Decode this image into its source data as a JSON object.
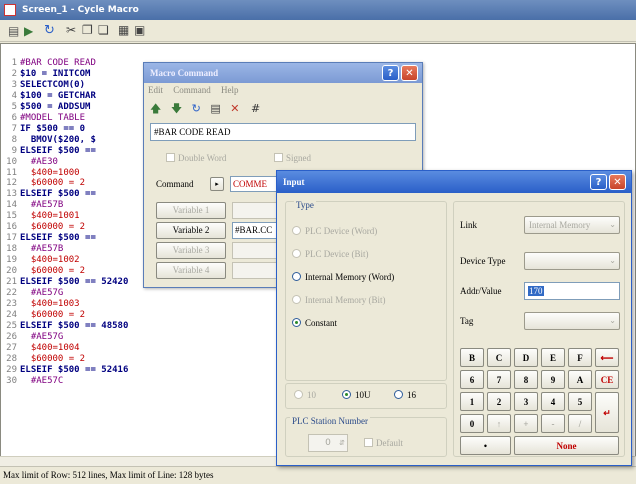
{
  "editor": {
    "title": "Screen_1 - Cycle Macro",
    "status": "Max limit of Row: 512 lines, Max limit of Line: 128 bytes",
    "lines": [
      {
        "n": "1",
        "t": "#BAR CODE READ"
      },
      {
        "n": "2",
        "t": "$10 = INITCOM"
      },
      {
        "n": "3",
        "t": "SELECTCOM(0)"
      },
      {
        "n": "4",
        "t": "$100 = GETCHAR"
      },
      {
        "n": "5",
        "t": "$500 = ADDSUM"
      },
      {
        "n": "6",
        "t": "#MODEL TABLE"
      },
      {
        "n": "7",
        "t": "IF $500 == 0"
      },
      {
        "n": "8",
        "t": "  BMOV($200, $"
      },
      {
        "n": "9",
        "t": "ELSEIF $500 =="
      },
      {
        "n": "10",
        "t": "  #AE30"
      },
      {
        "n": "11",
        "t": "  $400=1000"
      },
      {
        "n": "12",
        "t": "  $60000 = 2"
      },
      {
        "n": "13",
        "t": "ELSEIF $500 =="
      },
      {
        "n": "14",
        "t": "  #AE57B"
      },
      {
        "n": "15",
        "t": "  $400=1001"
      },
      {
        "n": "16",
        "t": "  $60000 = 2"
      },
      {
        "n": "17",
        "t": "ELSEIF $500 =="
      },
      {
        "n": "18",
        "t": "  #AE57B"
      },
      {
        "n": "19",
        "t": "  $400=1002"
      },
      {
        "n": "20",
        "t": "  $60000 = 2"
      },
      {
        "n": "21",
        "t": "ELSEIF $500 == 52420"
      },
      {
        "n": "22",
        "t": "  #AE57G"
      },
      {
        "n": "23",
        "t": "  $400=1003"
      },
      {
        "n": "24",
        "t": "  $60000 = 2"
      },
      {
        "n": "25",
        "t": "ELSEIF $500 == 48580"
      },
      {
        "n": "26",
        "t": "  #AE57G"
      },
      {
        "n": "27",
        "t": "  $400=1004"
      },
      {
        "n": "28",
        "t": "  $60000 = 2"
      },
      {
        "n": "29",
        "t": "ELSEIF $500 == 52416"
      },
      {
        "n": "30",
        "t": "  #AE57C"
      }
    ]
  },
  "macro": {
    "title": "Macro Command",
    "menu": [
      "Edit",
      "Command",
      "Help"
    ],
    "comment": "#BAR CODE READ",
    "double_word": "Double Word",
    "signed": "Signed",
    "command_label": "Command",
    "command_value": "COMME",
    "variables": [
      {
        "label": "Variable 1",
        "value": "",
        "enabled": false
      },
      {
        "label": "Variable 2",
        "value": "#BAR.CC",
        "enabled": true
      },
      {
        "label": "Variable 3",
        "value": "",
        "enabled": false
      },
      {
        "label": "Variable 4",
        "value": "",
        "enabled": false
      }
    ]
  },
  "input": {
    "title": "Input",
    "type_label": "Type",
    "types": [
      {
        "label": "PLC Device (Word)",
        "state": "disabled"
      },
      {
        "label": "PLC Device (Bit)",
        "state": "disabled"
      },
      {
        "label": "Internal Memory (Word)",
        "state": "off"
      },
      {
        "label": "Internal Memory (Bit)",
        "state": "disabled"
      },
      {
        "label": "Constant",
        "state": "on"
      }
    ],
    "bases": [
      {
        "label": "10",
        "state": "disabled"
      },
      {
        "label": "10U",
        "state": "on"
      },
      {
        "label": "16",
        "state": "off"
      }
    ],
    "plc_station_label": "PLC Station Number",
    "plc_station_value": "0",
    "default_label": "Default",
    "link_label": "Link",
    "link_value": "Internal Memory",
    "device_type_label": "Device Type",
    "device_type_value": "",
    "addr_label": "Addr/Value",
    "addr_value": "170",
    "tag_label": "Tag",
    "tag_value": "",
    "keypad": [
      [
        "B",
        "C",
        "D",
        "E",
        "F",
        "⟵"
      ],
      [
        "6",
        "7",
        "8",
        "9",
        "A",
        "CE"
      ],
      [
        "1",
        "2",
        "3",
        "4",
        "5",
        "↵"
      ],
      [
        "0",
        "↑",
        "+",
        "-",
        "/",
        ""
      ]
    ],
    "dot_key": "•",
    "none_key": "None",
    "colors": {
      "title": "#2a5fc8",
      "close": "#d0492c",
      "constant_dot": "#2a8a2a"
    }
  }
}
